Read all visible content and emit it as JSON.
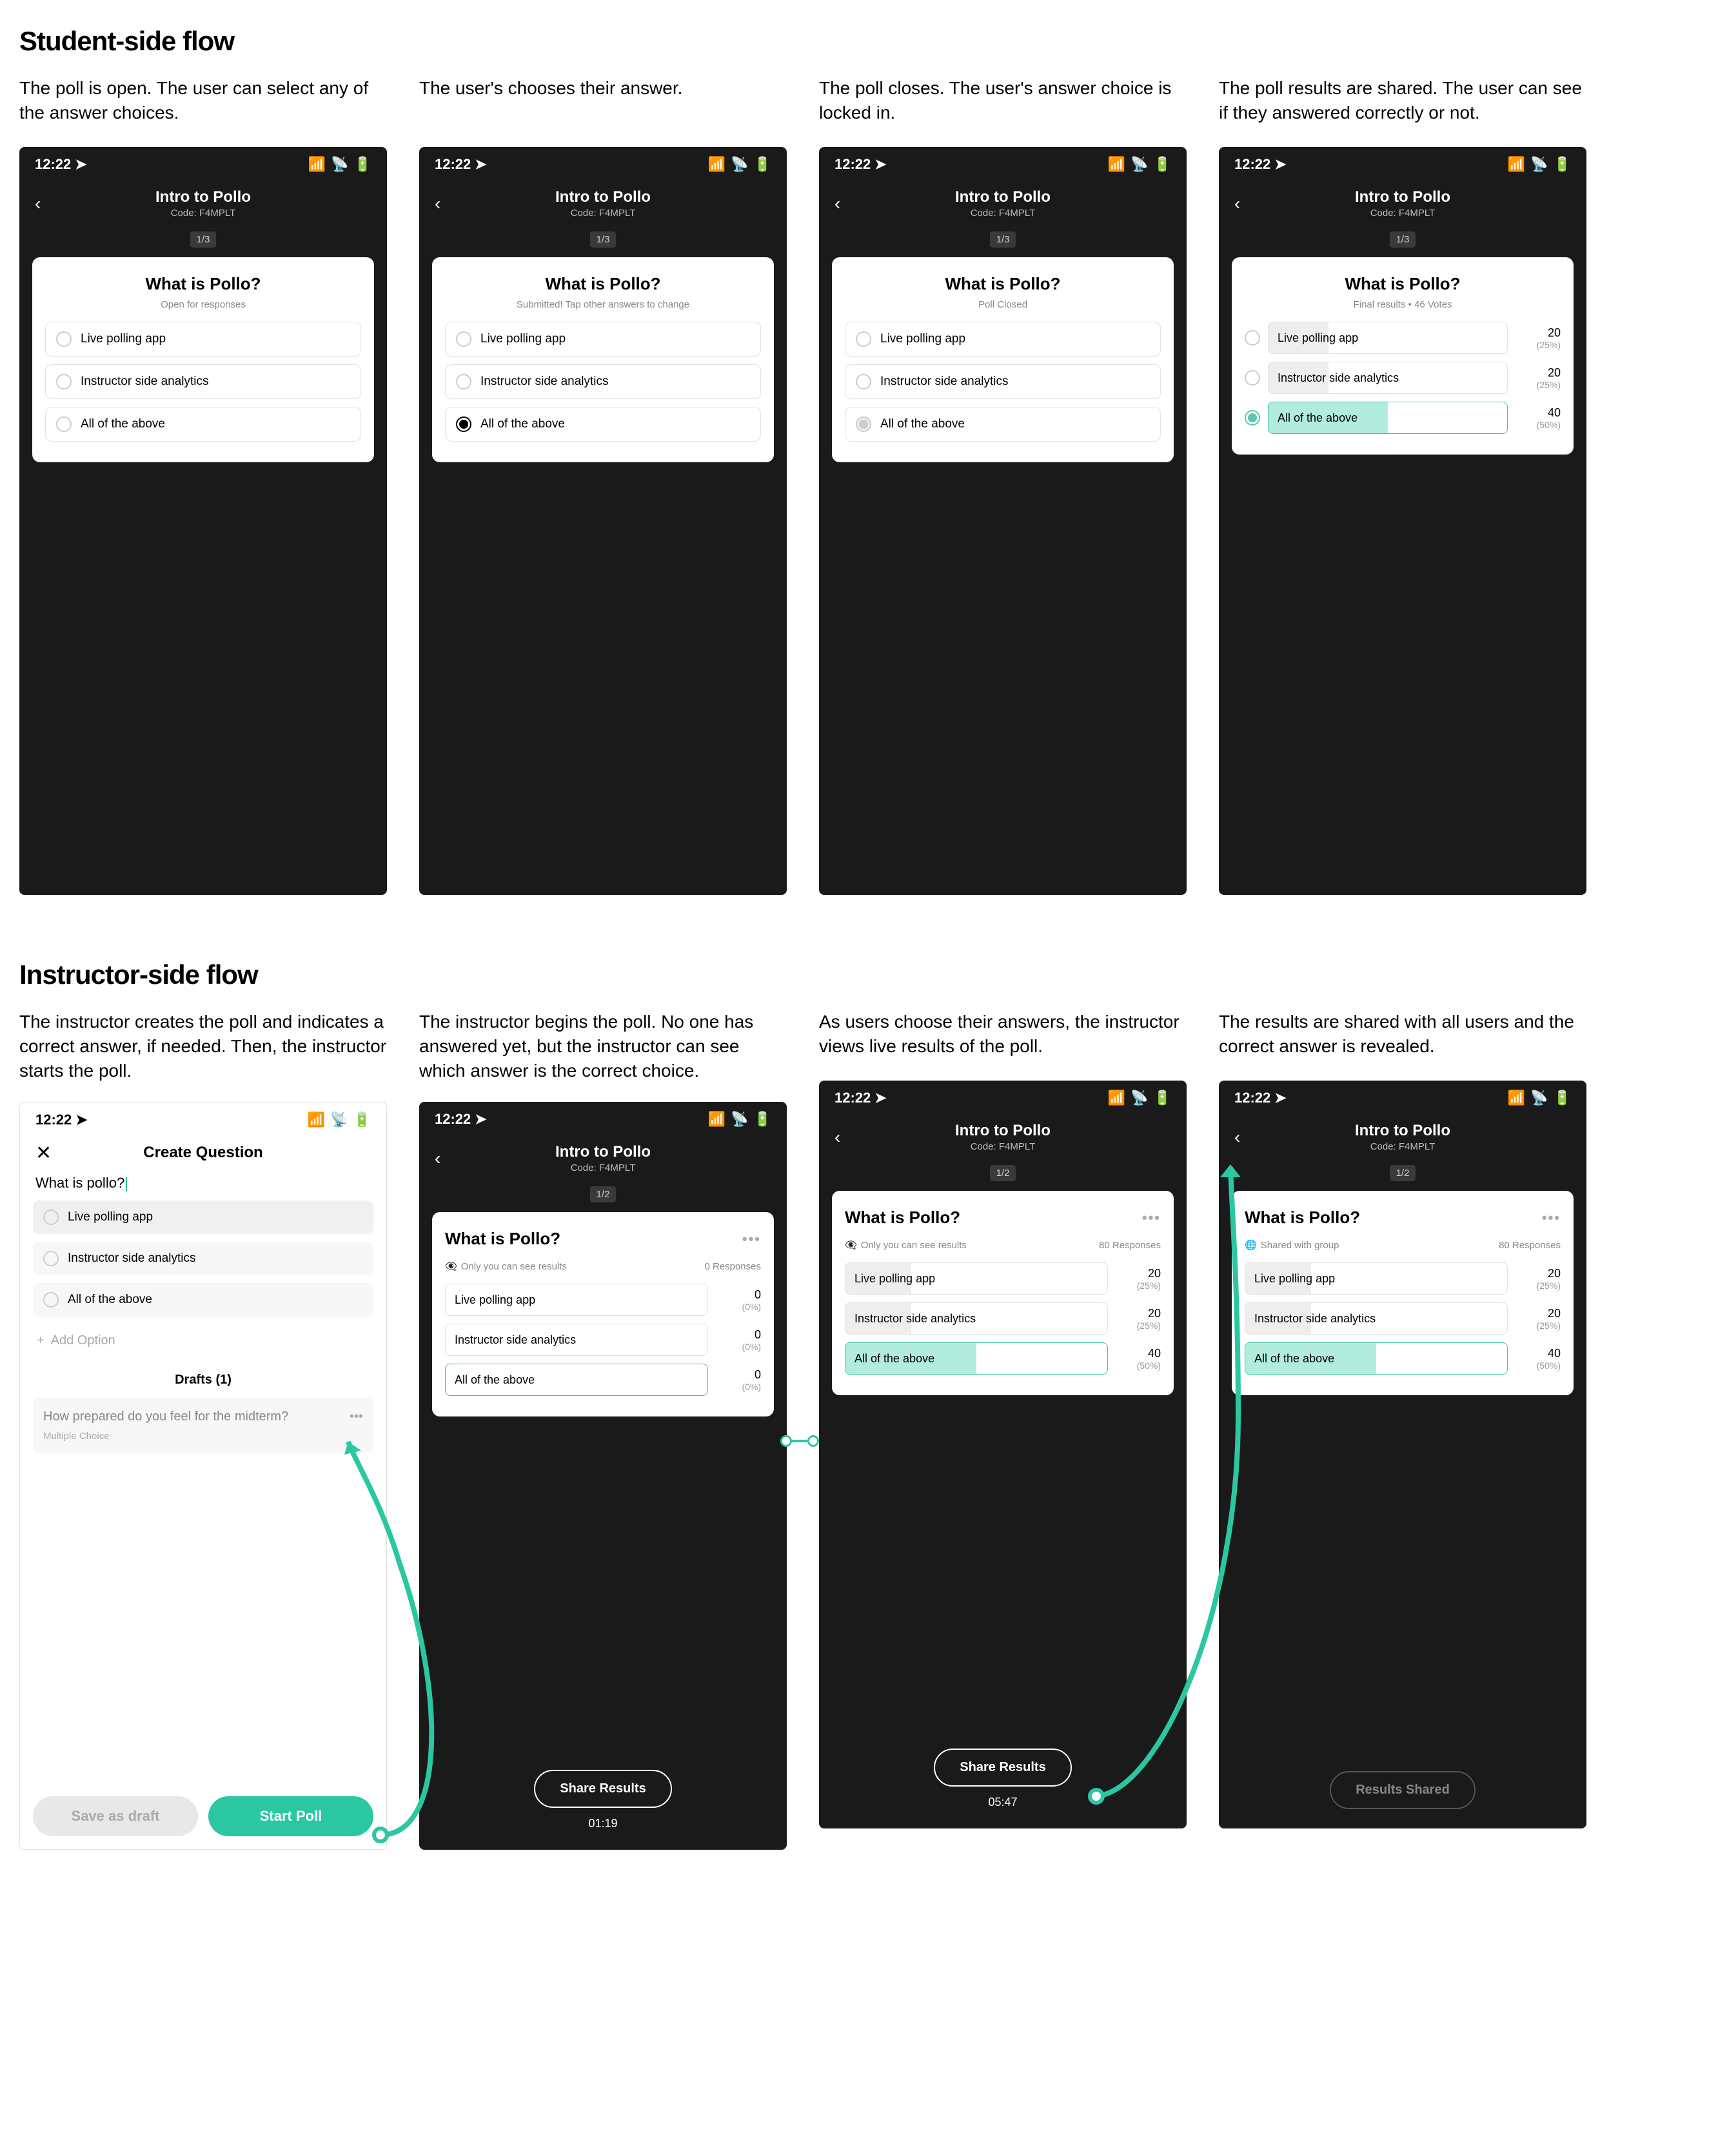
{
  "section_student": "Student-side flow",
  "section_instructor": "Instructor-side flow",
  "captions": {
    "s1": "The poll is open. The user can select any of the answer choices.",
    "s2": "The user's chooses their answer.",
    "s3": "The poll closes. The user's answer choice is locked in.",
    "s4": "The poll results are shared. The user can see if they answered correctly or not.",
    "i1": "The instructor creates the poll and indicates a correct answer, if needed. Then, the instructor starts the poll.",
    "i2": "The instructor begins the poll. No one has answered yet, but the instructor can see which answer is the correct choice.",
    "i3": "As users choose their answers, the instructor views live results of the poll.",
    "i4": "The results are shared with all users and the correct answer is revealed."
  },
  "status": {
    "time": "12:22"
  },
  "nav": {
    "title": "Intro to Pollo",
    "code": "Code: F4MPLT"
  },
  "create_title": "Create Question",
  "counter_s": "1/3",
  "counter_i": "1/2",
  "question": "What is Pollo?",
  "subs": {
    "open": "Open for responses",
    "submitted": "Submitted! Tap other answers to change",
    "closed": "Poll Closed",
    "final": "Final results • 46 Votes"
  },
  "answers": {
    "a1": "Live polling app",
    "a2": "Instructor side analytics",
    "a3": "All of the above"
  },
  "results": {
    "r1": {
      "count": "20",
      "pct": "(25%)",
      "w": "25%"
    },
    "r2": {
      "count": "20",
      "pct": "(25%)",
      "w": "25%"
    },
    "r3": {
      "count": "40",
      "pct": "(50%)",
      "w": "50%"
    }
  },
  "zero": {
    "count": "0",
    "pct": "(0%)",
    "w": "0%"
  },
  "vis": {
    "private": "Only you can see results",
    "shared": "Shared with group",
    "resp0": "0 Responses",
    "resp80": "80 Responses"
  },
  "create": {
    "input": "What is pollo?",
    "add": "Add Option",
    "drafts_h": "Drafts (1)",
    "draft_q": "How prepared do you feel for the midterm?",
    "draft_t": "Multiple Choice",
    "save": "Save as draft",
    "start": "Start Poll"
  },
  "buttons": {
    "share": "Share Results",
    "shared": "Results Shared"
  },
  "timers": {
    "t1": "01:19",
    "t2": "05:47"
  }
}
